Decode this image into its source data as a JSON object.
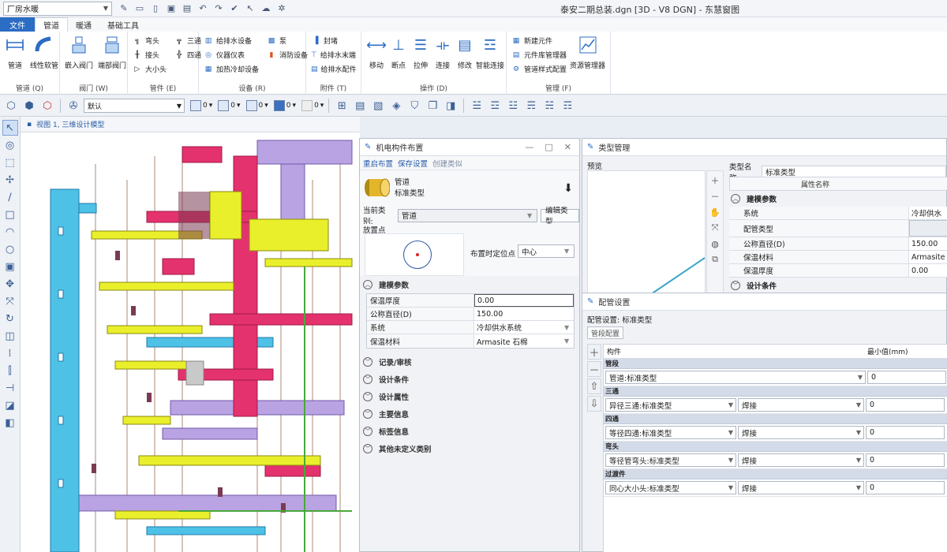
{
  "titlebar": {
    "workspace": "厂房水暖",
    "window_title": "泰安二期总装.dgn [3D - V8 DGN] - 东慧窗图",
    "quick_access_icons": [
      "open-icon",
      "new-icon",
      "save-icon",
      "print-icon",
      "undo-icon",
      "redo-icon",
      "pin-icon",
      "cursor-icon",
      "cloud-icon",
      "settings-icon"
    ]
  },
  "tabs": [
    "文件",
    "管道",
    "暖通",
    "基础工具"
  ],
  "ribbon": {
    "pipe_group": {
      "label": "管道 (Q)",
      "buttons": [
        "管道",
        "线性软管"
      ]
    },
    "valve_group": {
      "label": "阀门 (W)",
      "buttons": [
        "嵌入阀门",
        "端部阀门"
      ]
    },
    "fitting_group": {
      "label": "管件 (E)",
      "col1": [
        "弯头",
        "接头",
        "大小头"
      ],
      "col2": [
        "三通",
        "四通"
      ]
    },
    "equipment_group": {
      "label": "设备 (R)",
      "col1": [
        "给排水设备",
        "仪器仪表",
        "加热冷却设备"
      ],
      "col2": [
        "泵",
        "消防设备"
      ]
    },
    "attachment_group": {
      "label": "附件 (T)",
      "col1": [
        "封堵",
        "给排水末端",
        "给排水配件"
      ]
    },
    "operation_group": {
      "label": "操作 (D)",
      "buttons": [
        "移动",
        "断点",
        "拉伸",
        "连接",
        "修改",
        "智能连接"
      ]
    },
    "manage_group": {
      "label": "管理 (F)",
      "col1": [
        "新建元件",
        "元件库管理器",
        "管道样式配置"
      ],
      "buttons": [
        "资源管理器"
      ]
    }
  },
  "toolbar2": {
    "level": "默认",
    "picker_values": [
      "0",
      "0",
      "0",
      "0",
      "0"
    ]
  },
  "view": {
    "title": "视图 1, 三维设计模型"
  },
  "placement_panel": {
    "title": "机电构件布置",
    "links": [
      "重启布置",
      "保存设置",
      "创建类似"
    ],
    "element_type": "管道",
    "element_subtype": "标准类型",
    "category_label": "当前类别:",
    "category_value": "管道",
    "edit_type_button": "编辑类型",
    "placement_point_label": "放置点",
    "placement_pos_label": "布置时定位点",
    "placement_pos_value": "中心",
    "modeling_section": "建模参数",
    "params": [
      {
        "key": "保温厚度",
        "value": "0.00"
      },
      {
        "key": "公称直径(D)",
        "value": "150.00"
      },
      {
        "key": "系统",
        "value": "冷却供水系统"
      },
      {
        "key": "保温材料",
        "value": "Armasite 石棉"
      }
    ],
    "sections": [
      "记录/审核",
      "设计条件",
      "设计属性",
      "主要信息",
      "标签信息",
      "其他未定义类别"
    ]
  },
  "type_panel": {
    "title": "类型管理",
    "preview_label": "预览",
    "type_name_label": "类型名称",
    "type_name_value": "标准类型",
    "col_header": "属性名称",
    "section": "建模参数",
    "rows": [
      {
        "key": "系统",
        "value": "冷却供水"
      },
      {
        "key": "配管类型",
        "value": ""
      },
      {
        "key": "公称直径(D)",
        "value": "150.00"
      },
      {
        "key": "保温材料",
        "value": "Armasite"
      },
      {
        "key": "保温厚度",
        "value": "0.00"
      }
    ],
    "next_section": "设计条件"
  },
  "pipe_config_panel": {
    "title": "配管设置",
    "subtitle": "配管设置: 标准类型",
    "button": "管段配置",
    "col_component": "构件",
    "col_min": "最小值(mm)",
    "groups": [
      {
        "name": "管段",
        "item": "管道:标准类型",
        "join": "",
        "min": "0"
      },
      {
        "name": "三通",
        "item": "异径三通:标准类型",
        "join": "焊接",
        "min": "0"
      },
      {
        "name": "四通",
        "item": "等径四通:标准类型",
        "join": "焊接",
        "min": "0"
      },
      {
        "name": "弯头",
        "item": "等径管弯头:标准类型",
        "join": "焊接",
        "min": "0"
      },
      {
        "name": "过渡件",
        "item": "同心大小头:标准类型",
        "join": "焊接",
        "min": "0"
      }
    ]
  },
  "colors": {
    "accent": "#2b6cc4",
    "cyan_duct": "#4ec1e6",
    "magenta_duct": "#e4326e",
    "yellow_pipe": "#e9ef2a",
    "purple_duct": "#b9a3e3"
  }
}
